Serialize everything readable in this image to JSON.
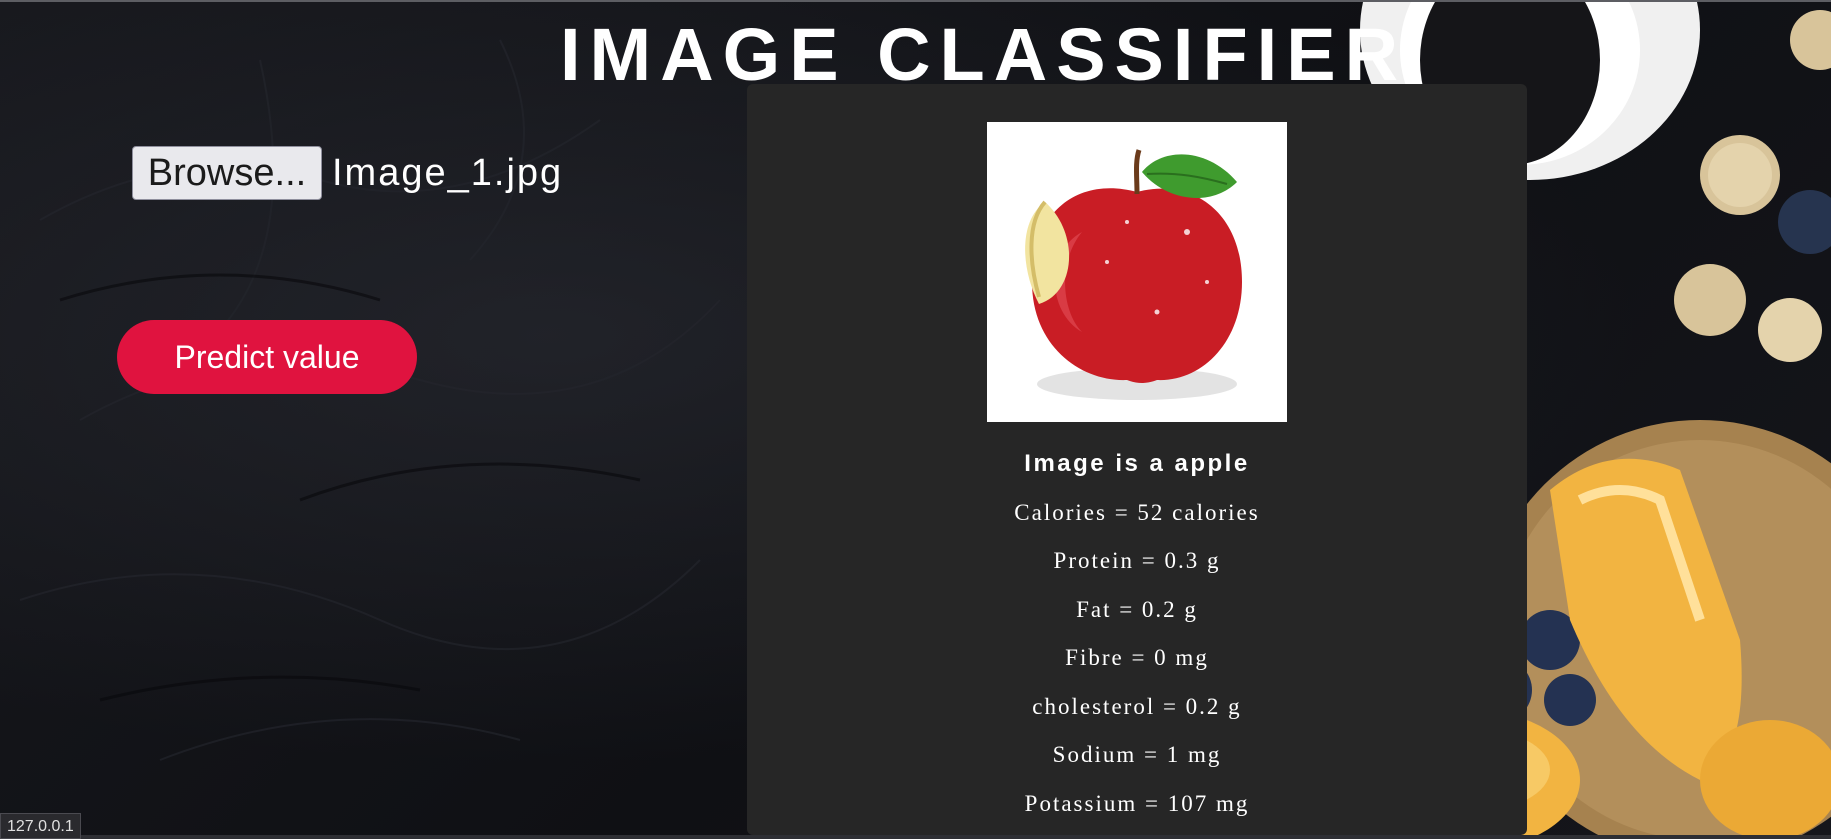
{
  "header": {
    "title": "IMAGE CLASSIFIER"
  },
  "upload": {
    "browse_label": "Browse...",
    "file_name": "Image_1.jpg"
  },
  "actions": {
    "predict_label": "Predict value"
  },
  "result": {
    "heading": "Image is a apple",
    "nutrients": [
      "Calories = 52 calories",
      "Protein = 0.3 g",
      "Fat = 0.2 g",
      "Fibre = 0 mg",
      "cholesterol = 0.2 g",
      "Sodium = 1 mg",
      "Potassium = 107 mg"
    ]
  },
  "status": {
    "url": "127.0.0.1"
  },
  "colors": {
    "background": "#121317",
    "card": "#262626",
    "accent": "#e0133f",
    "button": "#e9e9ed"
  }
}
